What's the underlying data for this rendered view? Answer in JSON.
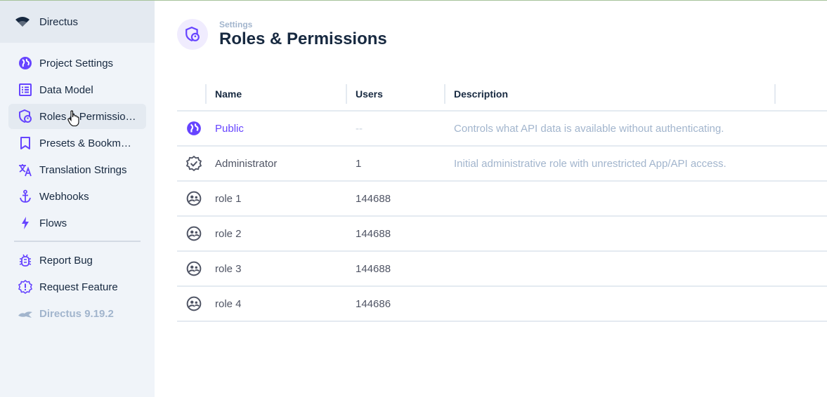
{
  "colors": {
    "accent": "#6644ff",
    "sidebar_bg": "#f0f4f9",
    "sidebar_active": "#e4eaf1",
    "muted_text": "#a2b5cd",
    "text": "#172940"
  },
  "brand": {
    "label": "Directus",
    "icon": "directus-logo-icon"
  },
  "sidebar": {
    "items": [
      {
        "label": "Project Settings",
        "icon": "public-globe-icon"
      },
      {
        "label": "Data Model",
        "icon": "list-alt-icon"
      },
      {
        "label": "Roles & Permissions",
        "icon": "admin-shield-icon",
        "active": true
      },
      {
        "label": "Presets & Bookmarks",
        "icon": "bookmark-icon"
      },
      {
        "label": "Translation Strings",
        "icon": "translate-icon"
      },
      {
        "label": "Webhooks",
        "icon": "anchor-icon"
      },
      {
        "label": "Flows",
        "icon": "bolt-icon"
      }
    ],
    "footer_items": [
      {
        "label": "Report Bug",
        "icon": "bug-icon"
      },
      {
        "label": "Request Feature",
        "icon": "new-releases-icon"
      }
    ],
    "version": "Directus 9.19.2"
  },
  "header": {
    "breadcrumb": "Settings",
    "title": "Roles & Permissions",
    "icon": "admin-shield-icon"
  },
  "table": {
    "columns": [
      "Name",
      "Users",
      "Description"
    ],
    "rows": [
      {
        "icon": "public-globe-icon",
        "name": "Public",
        "users": "--",
        "description": "Controls what API data is available without authenticating."
      },
      {
        "icon": "verified-icon",
        "name": "Administrator",
        "users": "1",
        "description": "Initial administrative role with unrestricted App/API access."
      },
      {
        "icon": "supervised-user-icon",
        "name": "role 1",
        "users": "144688",
        "description": ""
      },
      {
        "icon": "supervised-user-icon",
        "name": "role 2",
        "users": "144688",
        "description": ""
      },
      {
        "icon": "supervised-user-icon",
        "name": "role 3",
        "users": "144688",
        "description": ""
      },
      {
        "icon": "supervised-user-icon",
        "name": "role 4",
        "users": "144686",
        "description": ""
      }
    ]
  }
}
